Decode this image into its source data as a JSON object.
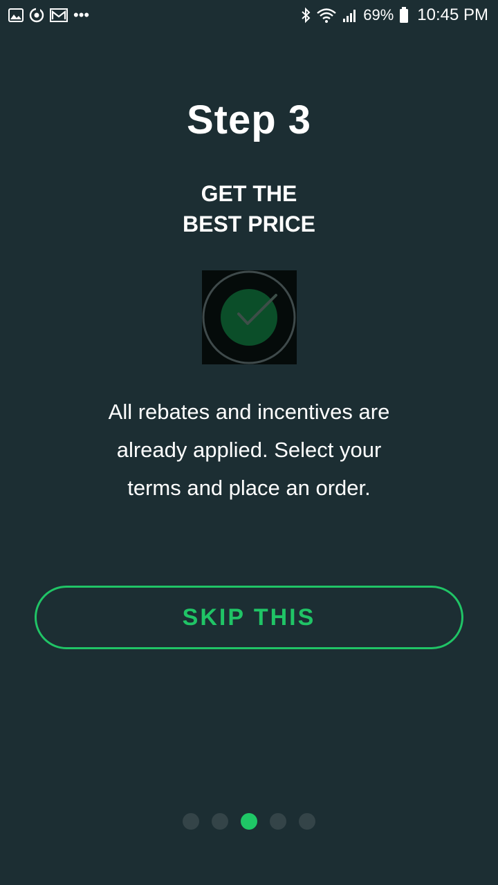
{
  "status_bar": {
    "left_icons": [
      "gallery-icon",
      "sync-icon",
      "gmail-icon",
      "more-notifications-icon"
    ],
    "more_label": "•••",
    "right_icons": [
      "bluetooth-icon",
      "wifi-icon",
      "signal-icon",
      "battery-icon"
    ],
    "battery_percent": "69%",
    "time": "10:45 PM"
  },
  "onboarding": {
    "step_title": "Step 3",
    "subtitle_line1": "GET THE",
    "subtitle_line2": "BEST PRICE",
    "illustration_icon": "checkmark-circle-icon",
    "description_line1": "All rebates and incentives are",
    "description_line2": "already applied. Select your",
    "description_line3": "terms and place an order.",
    "skip_label": "SKIP THIS"
  },
  "pagination": {
    "total": 5,
    "active_index": 2
  },
  "colors": {
    "background": "#1c2e33",
    "accent": "#20c466",
    "dot_inactive": "#344448",
    "text": "#ffffff"
  }
}
